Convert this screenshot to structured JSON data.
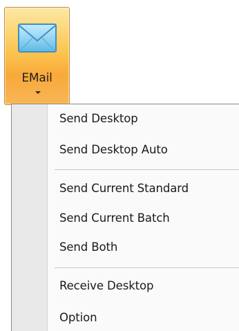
{
  "ribbon": {
    "email_button": {
      "label": "EMail",
      "icon": "envelope-icon",
      "has_dropdown": true
    }
  },
  "menu": {
    "items": [
      {
        "label": "Send Desktop"
      },
      {
        "label": "Send Desktop Auto"
      },
      {
        "label": "Send Current Standard"
      },
      {
        "label": "Send Current Batch"
      },
      {
        "label": "Send Both"
      },
      {
        "label": "Receive Desktop"
      },
      {
        "label": "Option"
      }
    ]
  },
  "colors": {
    "button_highlight": "#fbc24d",
    "button_border": "#c5883b",
    "menu_background": "#fafafa",
    "menu_gutter": "#e9e9e9",
    "envelope_fill": "#8fd3f3"
  }
}
